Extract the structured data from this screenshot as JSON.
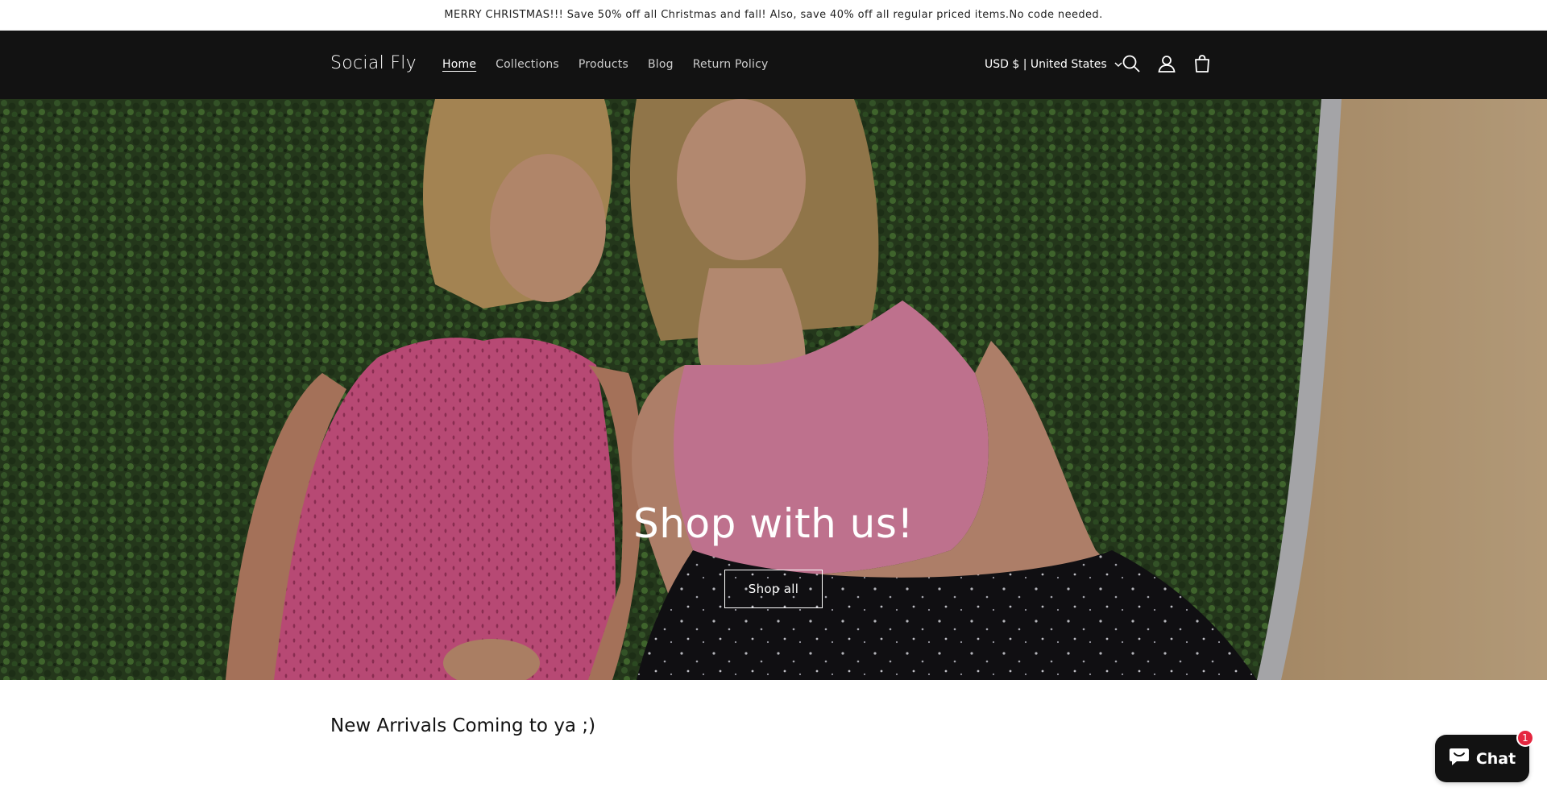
{
  "announcement": {
    "text": "MERRY CHRISTMAS!!! Save 50% off all Christmas and fall! Also, save 40% off all regular priced items.No code needed."
  },
  "header": {
    "logo": "Social Fly",
    "nav": [
      {
        "label": "Home",
        "active": true
      },
      {
        "label": "Collections",
        "active": false
      },
      {
        "label": "Products",
        "active": false
      },
      {
        "label": "Blog",
        "active": false
      },
      {
        "label": "Return Policy",
        "active": false
      }
    ],
    "localization": "USD $ | United States",
    "icons": [
      "search-icon",
      "account-icon",
      "cart-icon",
      "chevron-down-icon"
    ]
  },
  "hero": {
    "title": "Shop with us!",
    "button_label": "Shop all"
  },
  "section": {
    "title": "New Arrivals Coming to ya ;)"
  },
  "chat": {
    "label": "Chat",
    "badge": "1",
    "icon": "chat-bubble-icon"
  },
  "colors": {
    "header_bg": "#121212",
    "badge": "#e5263f",
    "hedge": "#2f4a24",
    "pink_top": "#e25f93",
    "pink_top_2": "#e88aac"
  }
}
